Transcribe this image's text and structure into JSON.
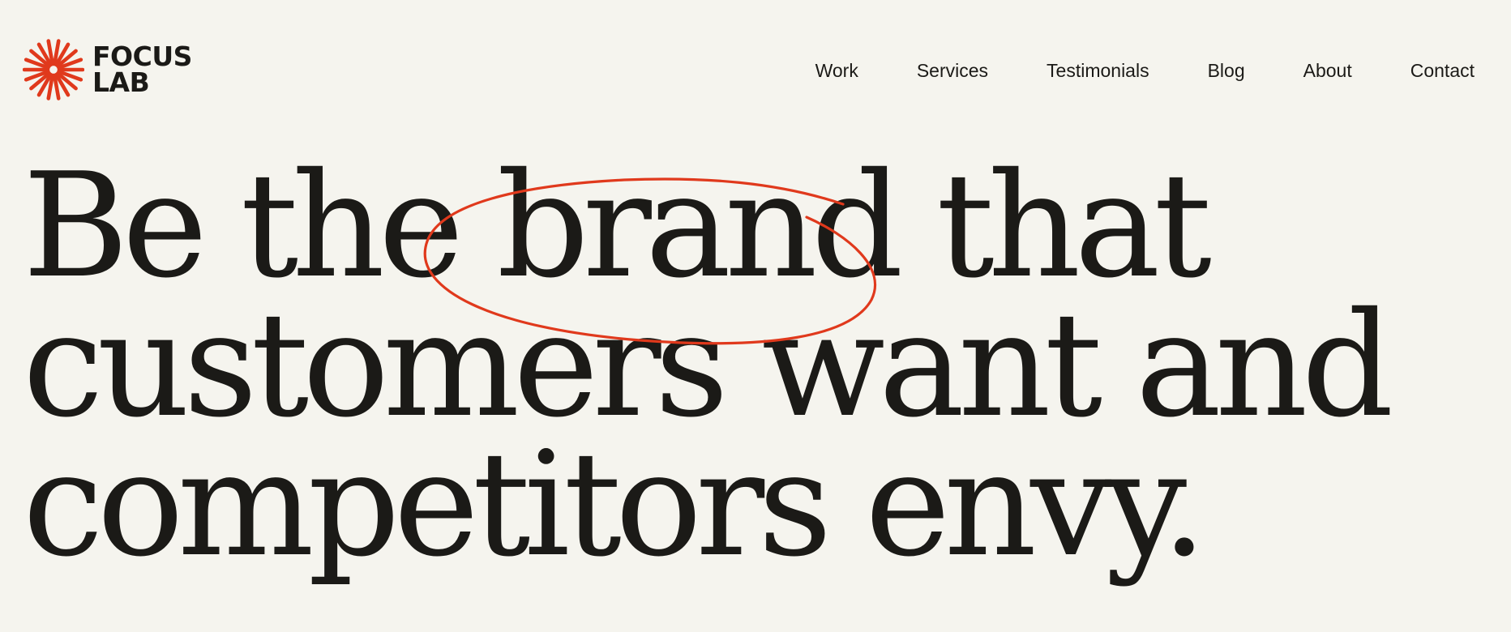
{
  "brand": {
    "name_line1": "FOCUS",
    "name_line2": "LAB",
    "accent_color": "#e0391c",
    "logo_icon": "starburst-icon"
  },
  "nav": {
    "items": [
      {
        "label": "Work"
      },
      {
        "label": "Services"
      },
      {
        "label": "Testimonials"
      },
      {
        "label": "Blog"
      },
      {
        "label": "About"
      },
      {
        "label": "Contact"
      }
    ]
  },
  "hero": {
    "line1_before": "Be the ",
    "line1_highlight": "brand",
    "line1_after": " that",
    "line2": "customers want and",
    "line3": "competitors envy."
  },
  "colors": {
    "background": "#f5f4ee",
    "text": "#1b1a17",
    "highlight_stroke": "#e0391c"
  }
}
